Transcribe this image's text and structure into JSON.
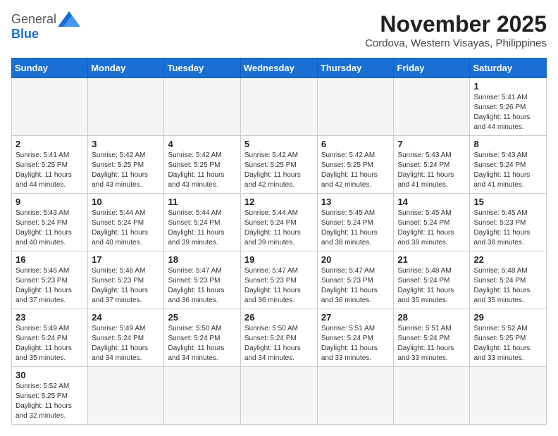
{
  "header": {
    "logo_general": "General",
    "logo_blue": "Blue",
    "month": "November 2025",
    "location": "Cordova, Western Visayas, Philippines"
  },
  "weekdays": [
    "Sunday",
    "Monday",
    "Tuesday",
    "Wednesday",
    "Thursday",
    "Friday",
    "Saturday"
  ],
  "weeks": [
    [
      {
        "day": "",
        "info": ""
      },
      {
        "day": "",
        "info": ""
      },
      {
        "day": "",
        "info": ""
      },
      {
        "day": "",
        "info": ""
      },
      {
        "day": "",
        "info": ""
      },
      {
        "day": "",
        "info": ""
      },
      {
        "day": "1",
        "info": "Sunrise: 5:41 AM\nSunset: 5:26 PM\nDaylight: 11 hours and 44 minutes."
      }
    ],
    [
      {
        "day": "2",
        "info": "Sunrise: 5:41 AM\nSunset: 5:25 PM\nDaylight: 11 hours and 44 minutes."
      },
      {
        "day": "3",
        "info": "Sunrise: 5:42 AM\nSunset: 5:25 PM\nDaylight: 11 hours and 43 minutes."
      },
      {
        "day": "4",
        "info": "Sunrise: 5:42 AM\nSunset: 5:25 PM\nDaylight: 11 hours and 43 minutes."
      },
      {
        "day": "5",
        "info": "Sunrise: 5:42 AM\nSunset: 5:25 PM\nDaylight: 11 hours and 42 minutes."
      },
      {
        "day": "6",
        "info": "Sunrise: 5:42 AM\nSunset: 5:25 PM\nDaylight: 11 hours and 42 minutes."
      },
      {
        "day": "7",
        "info": "Sunrise: 5:43 AM\nSunset: 5:24 PM\nDaylight: 11 hours and 41 minutes."
      },
      {
        "day": "8",
        "info": "Sunrise: 5:43 AM\nSunset: 5:24 PM\nDaylight: 11 hours and 41 minutes."
      }
    ],
    [
      {
        "day": "9",
        "info": "Sunrise: 5:43 AM\nSunset: 5:24 PM\nDaylight: 11 hours and 40 minutes."
      },
      {
        "day": "10",
        "info": "Sunrise: 5:44 AM\nSunset: 5:24 PM\nDaylight: 11 hours and 40 minutes."
      },
      {
        "day": "11",
        "info": "Sunrise: 5:44 AM\nSunset: 5:24 PM\nDaylight: 11 hours and 39 minutes."
      },
      {
        "day": "12",
        "info": "Sunrise: 5:44 AM\nSunset: 5:24 PM\nDaylight: 11 hours and 39 minutes."
      },
      {
        "day": "13",
        "info": "Sunrise: 5:45 AM\nSunset: 5:24 PM\nDaylight: 11 hours and 38 minutes."
      },
      {
        "day": "14",
        "info": "Sunrise: 5:45 AM\nSunset: 5:24 PM\nDaylight: 11 hours and 38 minutes."
      },
      {
        "day": "15",
        "info": "Sunrise: 5:45 AM\nSunset: 5:23 PM\nDaylight: 11 hours and 38 minutes."
      }
    ],
    [
      {
        "day": "16",
        "info": "Sunrise: 5:46 AM\nSunset: 5:23 PM\nDaylight: 11 hours and 37 minutes."
      },
      {
        "day": "17",
        "info": "Sunrise: 5:46 AM\nSunset: 5:23 PM\nDaylight: 11 hours and 37 minutes."
      },
      {
        "day": "18",
        "info": "Sunrise: 5:47 AM\nSunset: 5:23 PM\nDaylight: 11 hours and 36 minutes."
      },
      {
        "day": "19",
        "info": "Sunrise: 5:47 AM\nSunset: 5:23 PM\nDaylight: 11 hours and 36 minutes."
      },
      {
        "day": "20",
        "info": "Sunrise: 5:47 AM\nSunset: 5:23 PM\nDaylight: 11 hours and 36 minutes."
      },
      {
        "day": "21",
        "info": "Sunrise: 5:48 AM\nSunset: 5:24 PM\nDaylight: 11 hours and 35 minutes."
      },
      {
        "day": "22",
        "info": "Sunrise: 5:48 AM\nSunset: 5:24 PM\nDaylight: 11 hours and 35 minutes."
      }
    ],
    [
      {
        "day": "23",
        "info": "Sunrise: 5:49 AM\nSunset: 5:24 PM\nDaylight: 11 hours and 35 minutes."
      },
      {
        "day": "24",
        "info": "Sunrise: 5:49 AM\nSunset: 5:24 PM\nDaylight: 11 hours and 34 minutes."
      },
      {
        "day": "25",
        "info": "Sunrise: 5:50 AM\nSunset: 5:24 PM\nDaylight: 11 hours and 34 minutes."
      },
      {
        "day": "26",
        "info": "Sunrise: 5:50 AM\nSunset: 5:24 PM\nDaylight: 11 hours and 34 minutes."
      },
      {
        "day": "27",
        "info": "Sunrise: 5:51 AM\nSunset: 5:24 PM\nDaylight: 11 hours and 33 minutes."
      },
      {
        "day": "28",
        "info": "Sunrise: 5:51 AM\nSunset: 5:24 PM\nDaylight: 11 hours and 33 minutes."
      },
      {
        "day": "29",
        "info": "Sunrise: 5:52 AM\nSunset: 5:25 PM\nDaylight: 11 hours and 33 minutes."
      }
    ],
    [
      {
        "day": "30",
        "info": "Sunrise: 5:52 AM\nSunset: 5:25 PM\nDaylight: 11 hours and 32 minutes."
      },
      {
        "day": "",
        "info": ""
      },
      {
        "day": "",
        "info": ""
      },
      {
        "day": "",
        "info": ""
      },
      {
        "day": "",
        "info": ""
      },
      {
        "day": "",
        "info": ""
      },
      {
        "day": "",
        "info": ""
      }
    ]
  ]
}
